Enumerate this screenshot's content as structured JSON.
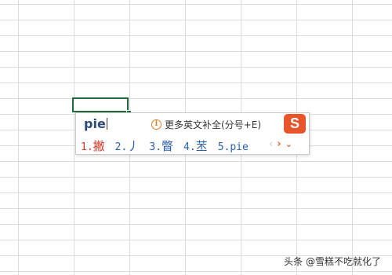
{
  "ime": {
    "composition": "pie",
    "hint_icon": "info-icon",
    "hint_text": "更多英文补全(分号+E)",
    "logo_letter": "S",
    "candidates": [
      {
        "index": "1.",
        "text": "撇"
      },
      {
        "index": "2.",
        "text": "丿"
      },
      {
        "index": "3.",
        "text": "瞥"
      },
      {
        "index": "4.",
        "text": "苤"
      },
      {
        "index": "5.",
        "text": "pie"
      }
    ],
    "prev_glyph": "‹",
    "next_glyph": "›",
    "expand_glyph": "⌄"
  },
  "watermark": "头条 @雪糕不吃就化了",
  "colors": {
    "accent": "#e0652e",
    "selected_cell_border": "#1e6b3c",
    "candidate_first": "#d23a2a",
    "candidate": "#2a5fa8"
  }
}
